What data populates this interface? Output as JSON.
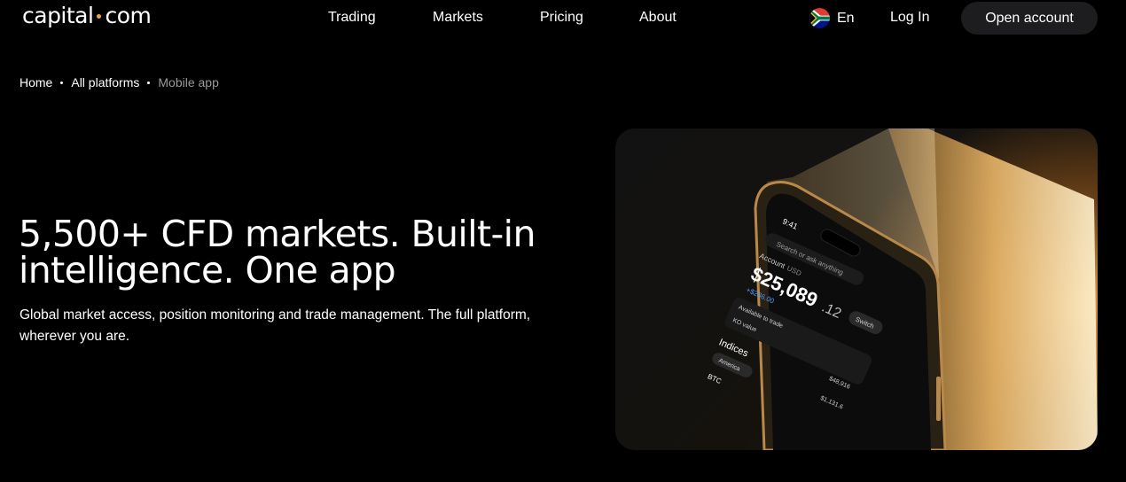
{
  "header": {
    "logo_left": "capital",
    "logo_right": "com",
    "nav": [
      "Trading",
      "Markets",
      "Pricing",
      "About"
    ],
    "language": "En",
    "login": "Log In",
    "open_account": "Open account"
  },
  "breadcrumb": {
    "items": [
      "Home",
      "All platforms",
      "Mobile app"
    ]
  },
  "hero": {
    "title": "5,500+ CFD markets. Built-in intelligence. One app",
    "subtitle": "Global market access, position monitoring and trade management. The full platform, wherever you are."
  },
  "phone_screen": {
    "time": "9:41",
    "search_placeholder": "Search or ask anything",
    "account_label": "Account",
    "account_currency": "USD",
    "balance_main": "$25,089",
    "balance_cents": ".12",
    "change": "+$236.00",
    "switch_label": "Switch",
    "available": "Available to trade",
    "ko_value": "KO value",
    "indices": "Indices",
    "america": "America",
    "btc": "BTC",
    "val1": "$48,916",
    "val2": "$1,131.6"
  },
  "colors": {
    "accent_dot": "#e9a53a",
    "button_bg": "#1d1d1f",
    "background": "#000000",
    "crumb_current": "#9a9a9a",
    "change_blue": "#4d9bff"
  }
}
